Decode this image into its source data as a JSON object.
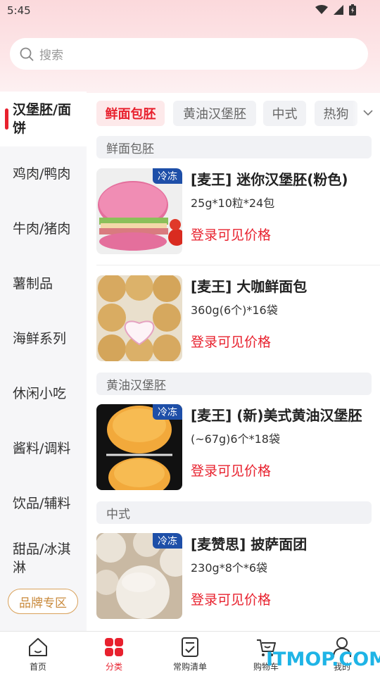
{
  "status_bar": {
    "time": "5:45"
  },
  "search": {
    "placeholder": "搜索"
  },
  "sidebar": {
    "items": [
      {
        "label": "汉堡胚/面饼",
        "active": true
      },
      {
        "label": "鸡肉/鸭肉"
      },
      {
        "label": "牛肉/猪肉"
      },
      {
        "label": "薯制品"
      },
      {
        "label": "海鲜系列"
      },
      {
        "label": "休闲小吃"
      },
      {
        "label": "酱料/调料"
      },
      {
        "label": "饮品/辅料"
      },
      {
        "label": "甜品/冰淇淋"
      }
    ],
    "brand_button": "品牌专区"
  },
  "chips": [
    "鲜面包胚",
    "黄油汉堡胚",
    "中式",
    "热狗"
  ],
  "sections": [
    {
      "title": "鲜面包胚"
    },
    {
      "title": "黄油汉堡胚"
    },
    {
      "title": "中式"
    }
  ],
  "products": [
    {
      "tag": "冷冻",
      "title": "[麦王] 迷你汉堡胚(粉色)",
      "spec": "25g*10粒*24包",
      "price": "登录可见价格"
    },
    {
      "tag": "",
      "title": "[麦王] 大咖鲜面包",
      "spec": "360g(6个)*16袋",
      "price": "登录可见价格"
    },
    {
      "tag": "冷冻",
      "title": "[麦王] (新)美式黄油汉堡胚",
      "spec": "(~67g)6个*18袋",
      "price": "登录可见价格"
    },
    {
      "tag": "冷冻",
      "title": "[麦赞思] 披萨面团",
      "spec": "230g*8个*6袋",
      "price": "登录可见价格"
    }
  ],
  "bottom_nav": [
    {
      "label": "首页",
      "icon": "home-icon"
    },
    {
      "label": "分类",
      "icon": "category-icon",
      "active": true
    },
    {
      "label": "常购清单",
      "icon": "list-icon"
    },
    {
      "label": "购物车",
      "icon": "cart-icon"
    },
    {
      "label": "我的",
      "icon": "user-icon"
    }
  ],
  "watermark": "ITMOP.COM",
  "colors": {
    "accent": "#e8212e",
    "frozen_tag": "#1e4fa8",
    "brand_gold": "#c98a3c"
  }
}
